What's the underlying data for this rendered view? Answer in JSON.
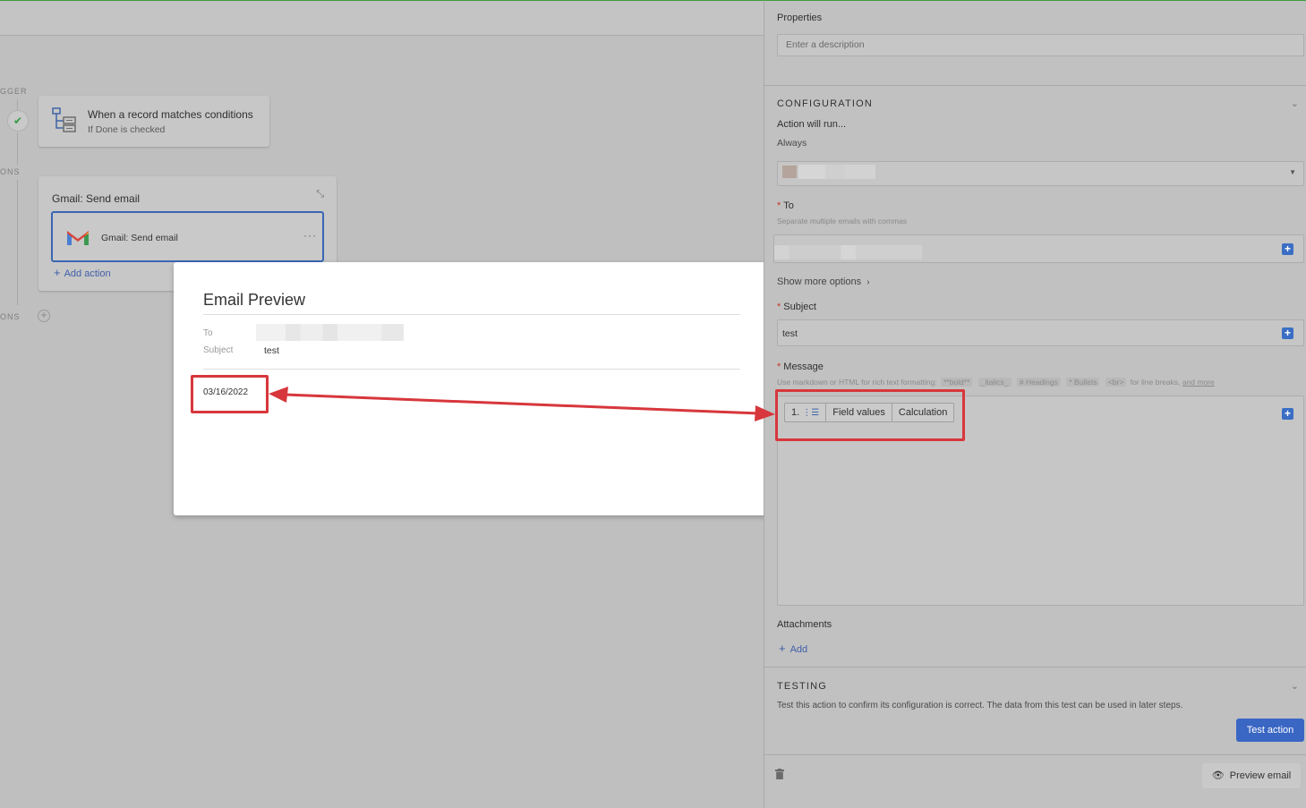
{
  "canvas": {
    "side_labels": [
      "GGER",
      "ONS",
      "ONS"
    ],
    "trigger": {
      "title": "When a record matches conditions",
      "subtitle": "If Done is checked",
      "icon": "hierarchy-conditions-icon"
    },
    "action_group": {
      "title": "Gmail: Send email",
      "step_label": "Gmail: Send email",
      "more": "···",
      "add_action": "Add action"
    }
  },
  "modal": {
    "title": "Email Preview",
    "to_label": "To",
    "subject_label": "Subject",
    "subject_value": "test",
    "body_date": "03/16/2022"
  },
  "panel": {
    "properties_title": "Properties",
    "description_placeholder": "Enter a description",
    "configuration": {
      "heading": "CONFIGURATION",
      "action_will_run": "Action will run...",
      "run_condition": "Always",
      "to_label": "To",
      "to_hint": "Separate multiple emails with commas",
      "show_more": "Show more options",
      "subject_label": "Subject",
      "subject_value": "test",
      "message_label": "Message",
      "message_hint_prefix": "Use markdown or HTML for rich text formatting:",
      "message_hint_chips": [
        "**bold**",
        "_italics_",
        "# Headings",
        "* Bullets",
        "<br>"
      ],
      "message_hint_suffix": "for line breaks,",
      "message_hint_link": "and more",
      "token": {
        "step": "1.",
        "field": "Field values",
        "calc": "Calculation"
      },
      "attachments_label": "Attachments",
      "attachments_add": "Add"
    },
    "testing": {
      "heading": "TESTING",
      "description": "Test this action to confirm its configuration is correct. The data from this test can be used in later steps.",
      "test_button": "Test action"
    },
    "footer": {
      "preview_button": "Preview email"
    }
  },
  "colors": {
    "highlight": "#d7373c",
    "accent": "#3a66c4",
    "check": "#2e9c43"
  }
}
